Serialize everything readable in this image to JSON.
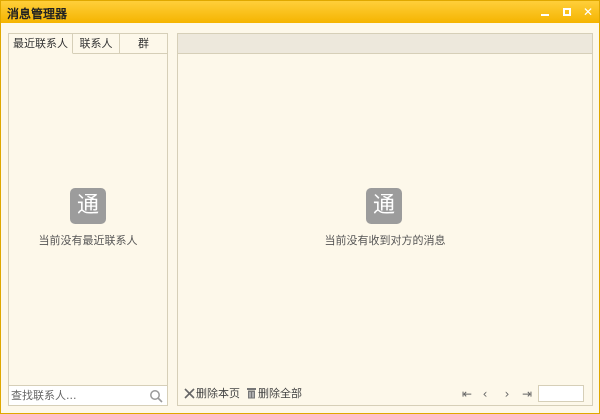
{
  "window": {
    "title": "消息管理器",
    "minimize_icon": "minimize-icon",
    "maximize_icon": "maximize-icon",
    "close_glyph": "✕"
  },
  "left": {
    "tabs": [
      {
        "label": "最近联系人",
        "active": true
      },
      {
        "label": "联系人",
        "active": false
      },
      {
        "label": "群",
        "active": false
      }
    ],
    "empty_icon_glyph": "通",
    "empty_text": "当前没有最近联系人",
    "search": {
      "placeholder": "查找联系人..."
    }
  },
  "right": {
    "empty_icon_glyph": "通",
    "empty_text": "当前没有收到对方的消息",
    "actions": {
      "delete_page": "删除本页",
      "delete_all": "删除全部"
    },
    "pager": {
      "first": "⇤",
      "prev": "‹",
      "next": "›",
      "last": "⇥"
    }
  },
  "colors": {
    "titlebar": "#f5b400",
    "background": "#fdf8ea",
    "icon_gray": "#9c9c9c"
  }
}
